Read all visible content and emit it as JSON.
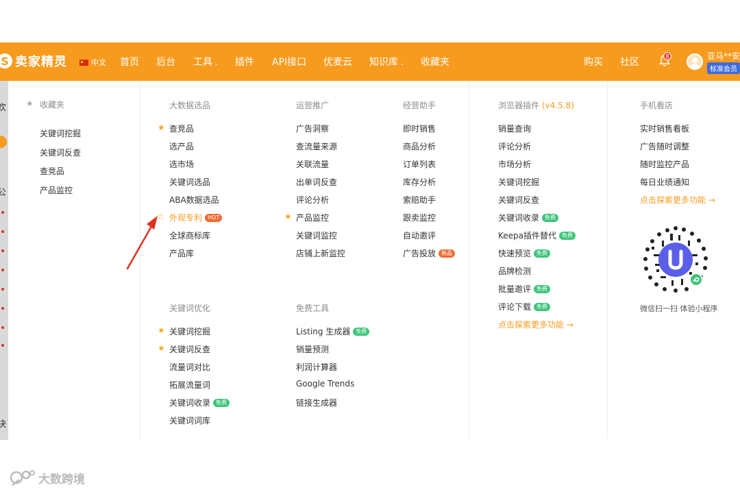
{
  "nav": {
    "logo_text": "卖家精灵",
    "logo_mark": "S",
    "language": "中文",
    "items": [
      {
        "label": "首页"
      },
      {
        "label": "后台"
      },
      {
        "label": "工具"
      },
      {
        "label": "插件"
      },
      {
        "label": "API接口"
      },
      {
        "label": "优麦云"
      },
      {
        "label": "知识库"
      },
      {
        "label": "收藏夹"
      }
    ],
    "right_items": [
      {
        "label": "购买"
      },
      {
        "label": "社区"
      }
    ],
    "notification_count": "8",
    "user_name": "亚马**安",
    "member_badge": "标准会员",
    "caret_icon": "chevron-down-icon"
  },
  "left_strip": {
    "text_1": "欢",
    "text_2": "公",
    "text_3": "块"
  },
  "favorites": {
    "title": "收藏夹",
    "items": [
      "关键词挖掘",
      "关键词反查",
      "查竞品",
      "产品监控"
    ]
  },
  "columns": {
    "big_data": {
      "title": "大数据选品",
      "items": [
        "查竞品",
        "选产品",
        "选市场",
        "关键词选品",
        "ABA数据选品",
        "外观专利",
        "全球商标库",
        "产品库"
      ],
      "hot_tag": "HOT"
    },
    "promotion": {
      "title": "运营推广",
      "items": [
        "广告洞察",
        "查流量来源",
        "关联流量",
        "出单词反查",
        "评论分析",
        "产品监控",
        "关键词监控",
        "店铺上新监控"
      ]
    },
    "assistant": {
      "title": "经营助手",
      "items": [
        "即时销售",
        "商品分析",
        "订单列表",
        "库存分析",
        "索赔助手",
        "跟卖监控",
        "自动邀评",
        "广告投放"
      ],
      "new_tag": "新品"
    },
    "keyword_opt": {
      "title": "关键词优化",
      "items": [
        "关键词挖掘",
        "关键词反查",
        "流量词对比",
        "拓展流量词",
        "关键词收录",
        "关键词词库"
      ]
    },
    "free_tools": {
      "title": "免费工具",
      "items": [
        "Listing 生成器",
        "销量预测",
        "利润计算器",
        "Google Trends",
        "链接生成器"
      ]
    },
    "browser_plugin": {
      "title": "浏览器插件",
      "version": "(v4.5.8)",
      "items": [
        "销量查询",
        "评论分析",
        "市场分析",
        "关键词挖掘",
        "关键词反查",
        "关键词收录",
        "Keepa插件替代",
        "快速预览",
        "品牌检测",
        "批量邀评",
        "评论下载"
      ],
      "more": "点击探索更多功能 →"
    },
    "mobile": {
      "title": "手机看店",
      "items": [
        "实时销售看板",
        "广告随时调整",
        "随时监控产品",
        "每日业绩通知"
      ],
      "more": "点击探索更多功能 →",
      "qr_caption": "微信扫一扫 体验小程序"
    }
  },
  "tags": {
    "free": "免费"
  },
  "watermark": {
    "text": "大数跨境"
  },
  "colors": {
    "brand": "#f79b1e",
    "member_badge": "#3e6bde",
    "free_tag": "#3ec47a",
    "hot_tag": "#f06b33",
    "arrow": "#e0301e"
  }
}
